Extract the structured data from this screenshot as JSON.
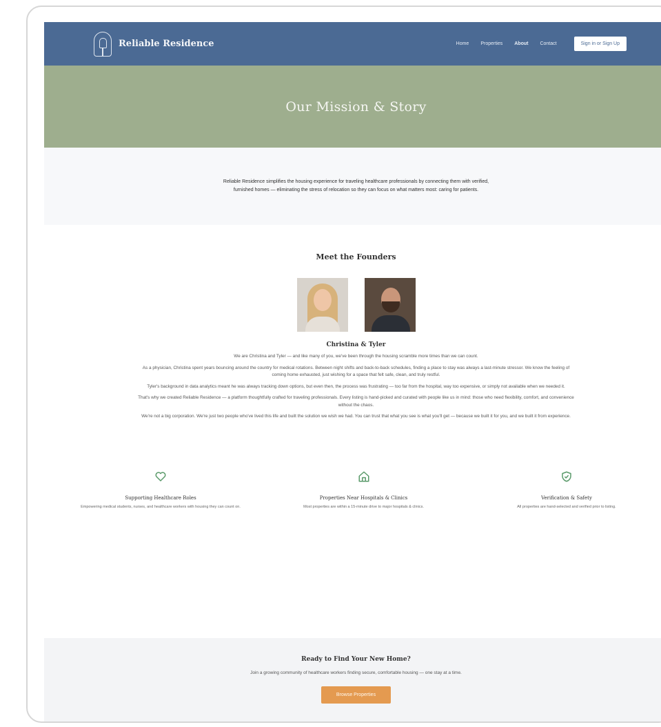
{
  "nav": {
    "brand": "Reliable Residence",
    "links": [
      "Home",
      "Properties",
      "About",
      "Contact"
    ],
    "signin": "Sign in or Sign Up"
  },
  "hero": {
    "title": "Our Mission & Story"
  },
  "intro": {
    "text": "Reliable Residence simplifies the housing experience for traveling healthcare professionals by connecting them with verified, furnished homes — eliminating the stress of relocation so they can focus on what matters most: caring for patients."
  },
  "founders": {
    "title": "Meet the Founders",
    "names": "Christina & Tyler",
    "p1": "We are Christina and Tyler — and like many of you, we've been through the housing scramble more times than we can count.",
    "p2": "As a physician, Christina spent years bouncing around the country for medical rotations. Between night shifts and back-to-back schedules, finding a place to stay was always a last-minute stressor. We know the feeling of coming home exhausted, just wishing for a space that felt safe, clean, and truly restful.",
    "p3": "Tyler's background in data analytics meant he was always tracking down options, but even then, the process was frustrating — too far from the hospital, way too expensive, or simply not available when we needed it.",
    "p4": "That's why we created Reliable Residence — a platform thoughtfully crafted for traveling professionals. Every listing is hand-picked and curated with people like us in mind: those who need flexibility, comfort, and convenience without the chaos.",
    "p5": "We're not a big corporation. We're just two people who've lived this life and built the solution we wish we had. You can trust that what you see is what you'll get — because we built it for you, and we built it from experience."
  },
  "features": [
    {
      "icon": "heart-icon",
      "title": "Supporting Healthcare Roles",
      "desc": "Empowering medical students, nurses, and healthcare workers with housing they can count on."
    },
    {
      "icon": "home-icon",
      "title": "Properties Near Hospitals & Clinics",
      "desc": "Most properties are within a 15-minute drive to major hospitals & clinics."
    },
    {
      "icon": "shield-check-icon",
      "title": "Verification & Safety",
      "desc": "All properties are hand-selected and verified prior to listing."
    }
  ],
  "cta": {
    "title": "Ready to Find Your New Home?",
    "text": "Join a growing community of healthcare workers finding secure, comfortable housing — one stay at a time.",
    "button": "Browse Properties"
  },
  "colors": {
    "nav": "#4b6a94",
    "hero": "#9eae8e",
    "accent": "#e49a50",
    "icon_green": "#5a9a6a"
  }
}
